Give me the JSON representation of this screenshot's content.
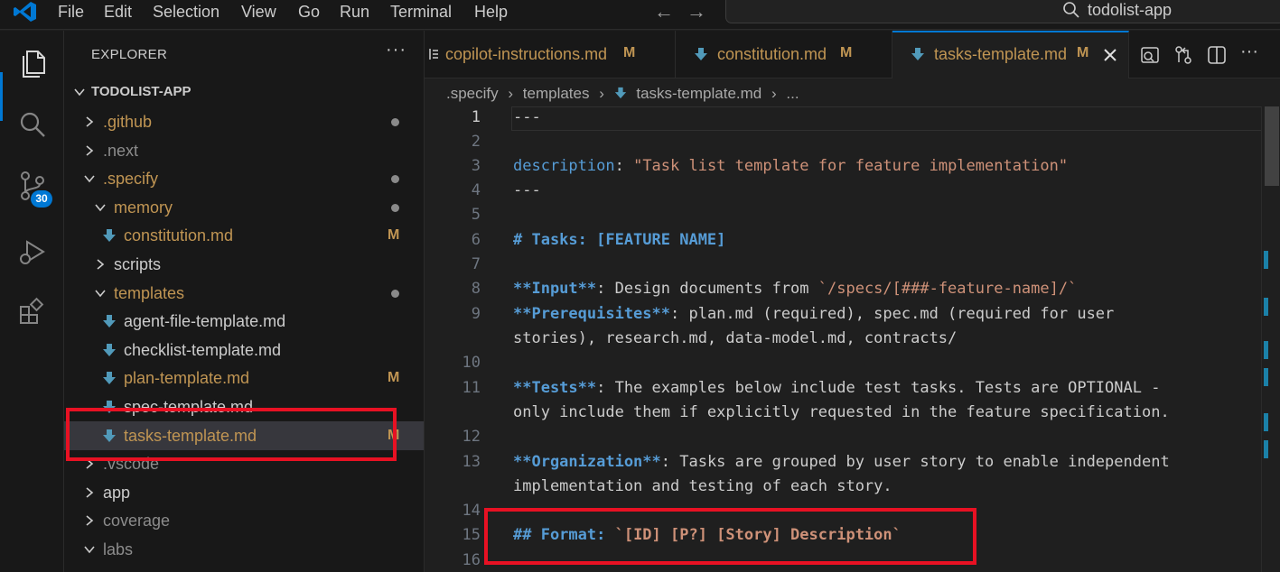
{
  "menu": [
    "File",
    "Edit",
    "Selection",
    "View",
    "Go",
    "Run",
    "Terminal",
    "Help"
  ],
  "search": {
    "text": "todolist-app"
  },
  "activity": {
    "scm_badge": "30"
  },
  "explorer": {
    "title": "EXPLORER",
    "more": "···",
    "root": "TODOLIST-APP",
    "items": [
      {
        "label": ".github",
        "color": "#c09553"
      },
      {
        "label": ".next",
        "color": "#8c8c8c"
      },
      {
        "label": ".specify",
        "color": "#c09553"
      },
      {
        "label": "memory",
        "color": "#c09553"
      },
      {
        "label": "constitution.md",
        "color": "#c09553",
        "status": "M"
      },
      {
        "label": "scripts",
        "color": "#cccccc"
      },
      {
        "label": "templates",
        "color": "#c09553"
      },
      {
        "label": "agent-file-template.md",
        "color": "#cccccc"
      },
      {
        "label": "checklist-template.md",
        "color": "#cccccc"
      },
      {
        "label": "plan-template.md",
        "color": "#c09553",
        "status": "M"
      },
      {
        "label": "spec-template.md",
        "color": "#cccccc"
      },
      {
        "label": "tasks-template.md",
        "color": "#c09553",
        "status": "M"
      },
      {
        "label": ".vscode",
        "color": "#8c8c8c"
      },
      {
        "label": "app",
        "color": "#cccccc"
      },
      {
        "label": "coverage",
        "color": "#8c8c8c"
      },
      {
        "label": "labs",
        "color": "#8c8c8c"
      }
    ]
  },
  "tabs": [
    {
      "label": "copilot-instructions.md",
      "status": "M"
    },
    {
      "label": "constitution.md",
      "status": "M"
    },
    {
      "label": "tasks-template.md",
      "status": "M"
    }
  ],
  "breadcrumb": [
    ".specify",
    "templates",
    "tasks-template.md",
    "..."
  ],
  "code": {
    "line_numbers": [
      "1",
      "2",
      "3",
      "4",
      "5",
      "6",
      "7",
      "8",
      "9",
      "10",
      "11",
      "12",
      "13",
      "14",
      "15",
      "16"
    ],
    "l1": "---",
    "l3_key": "description",
    "l3_colon": ": ",
    "l3_str": "\"Task list template for feature implementation\"",
    "l4": "---",
    "l6": "# Tasks: [FEATURE NAME]",
    "l8_bold": "**Input**",
    "l8_text": ": Design documents from ",
    "l8_code": "`/specs/[###-feature-name]/`",
    "l9_bold": "**Prerequisites**",
    "l9_text": ": plan.md (required), spec.md (required for user",
    "l9_cont": "stories), research.md, data-model.md, contracts/",
    "l11_bold": "**Tests**",
    "l11_text": ": The examples below include test tasks. Tests are OPTIONAL -",
    "l11_cont": "only include them if explicitly requested in the feature specification.",
    "l13_bold": "**Organization**",
    "l13_text": ": Tasks are grouped by user story to enable independent",
    "l13_cont": "implementation and testing of each story.",
    "l15_head": "## Format: ",
    "l15_code": "`[ID] [P?] [Story] Description`"
  },
  "colors": {
    "accent": "#0078d4",
    "modified": "#c09553",
    "highlight": "#e81123"
  }
}
